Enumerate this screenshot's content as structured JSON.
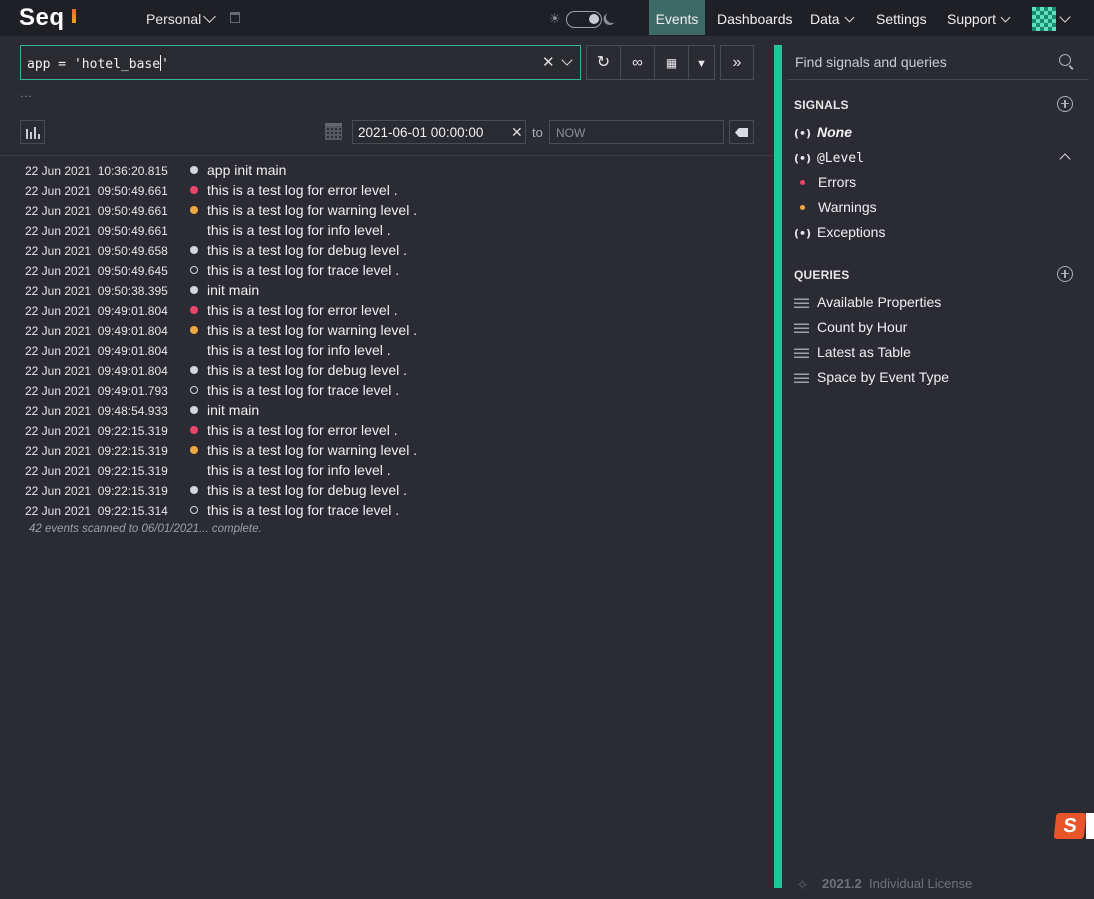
{
  "app": {
    "logo": "Seq"
  },
  "topnav": {
    "workspace": "Personal",
    "items": [
      {
        "label": "Events",
        "active": true
      },
      {
        "label": "Dashboards"
      },
      {
        "label": "Data"
      },
      {
        "label": "Settings"
      },
      {
        "label": "Support"
      }
    ]
  },
  "query": {
    "text": "app = 'hotel_base",
    "text_suffix": "'",
    "more": "..."
  },
  "range": {
    "from": "2021-06-01 00:00:00",
    "to_label": "to",
    "to_placeholder": "NOW"
  },
  "events": [
    {
      "time": "22 Jun 2021  10:36:20.815",
      "level": "info-dot",
      "message": "app init main"
    },
    {
      "time": "22 Jun 2021  09:50:49.661",
      "level": "error",
      "message": "this is a test log for error level ."
    },
    {
      "time": "22 Jun 2021  09:50:49.661",
      "level": "warning",
      "message": "this is a test log for warning level ."
    },
    {
      "time": "22 Jun 2021  09:50:49.661",
      "level": "none",
      "message": "this is a test log for info level ."
    },
    {
      "time": "22 Jun 2021  09:50:49.658",
      "level": "debug",
      "message": "this is a test log for debug level ."
    },
    {
      "time": "22 Jun 2021  09:50:49.645",
      "level": "trace",
      "message": "this is a test log for trace level ."
    },
    {
      "time": "22 Jun 2021  09:50:38.395",
      "level": "debug",
      "message": "init main"
    },
    {
      "time": "22 Jun 2021  09:49:01.804",
      "level": "error",
      "message": "this is a test log for error level ."
    },
    {
      "time": "22 Jun 2021  09:49:01.804",
      "level": "warning",
      "message": "this is a test log for warning level ."
    },
    {
      "time": "22 Jun 2021  09:49:01.804",
      "level": "none",
      "message": "this is a test log for info level ."
    },
    {
      "time": "22 Jun 2021  09:49:01.804",
      "level": "debug",
      "message": "this is a test log for debug level ."
    },
    {
      "time": "22 Jun 2021  09:49:01.793",
      "level": "trace",
      "message": "this is a test log for trace level ."
    },
    {
      "time": "22 Jun 2021  09:48:54.933",
      "level": "debug",
      "message": "init main"
    },
    {
      "time": "22 Jun 2021  09:22:15.319",
      "level": "error",
      "message": "this is a test log for error level ."
    },
    {
      "time": "22 Jun 2021  09:22:15.319",
      "level": "warning",
      "message": "this is a test log for warning level ."
    },
    {
      "time": "22 Jun 2021  09:22:15.319",
      "level": "none",
      "message": "this is a test log for info level ."
    },
    {
      "time": "22 Jun 2021  09:22:15.319",
      "level": "debug",
      "message": "this is a test log for debug level ."
    },
    {
      "time": "22 Jun 2021  09:22:15.314",
      "level": "trace",
      "message": "this is a test log for trace level ."
    }
  ],
  "status_line": "42 events scanned to 06/01/2021... complete.",
  "sidebar": {
    "search_placeholder": "Find signals and queries",
    "signals_header": "SIGNALS",
    "signals": [
      {
        "label": "None"
      },
      {
        "label": "@Level"
      },
      {
        "label": "Exceptions"
      }
    ],
    "level_subitems": [
      {
        "label": "Errors",
        "color": "#e8476a"
      },
      {
        "label": "Warnings",
        "color": "#f0a840"
      }
    ],
    "queries_header": "QUERIES",
    "queries": [
      {
        "label": "Available Properties"
      },
      {
        "label": "Count by Hour"
      },
      {
        "label": "Latest as Table"
      },
      {
        "label": "Space by Event Type"
      }
    ],
    "version": "2021.2",
    "license": "Individual License"
  },
  "colors": {
    "accent": "#24c39b",
    "error": "#e8476a",
    "warning": "#f0a840",
    "debug": "#d4d6da"
  },
  "overlay": {
    "badge": "S"
  }
}
